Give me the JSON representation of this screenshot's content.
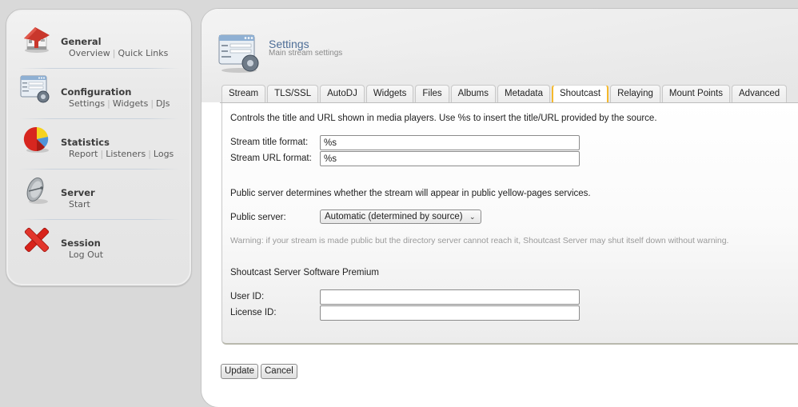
{
  "sidebar": {
    "groups": [
      {
        "title": "General",
        "icon": "house-icon",
        "links": [
          "Overview",
          "Quick Links"
        ]
      },
      {
        "title": "Configuration",
        "icon": "settings-form-icon",
        "links": [
          "Settings",
          "Widgets",
          "DJs"
        ]
      },
      {
        "title": "Statistics",
        "icon": "pie-chart-icon",
        "links": [
          "Report",
          "Listeners",
          "Logs"
        ]
      },
      {
        "title": "Server",
        "icon": "satellite-dish-icon",
        "links": [
          "Start"
        ]
      },
      {
        "title": "Session",
        "icon": "red-x-icon",
        "links": [
          "Log Out"
        ]
      }
    ]
  },
  "header": {
    "title": "Settings",
    "subtitle": "Main stream settings",
    "icon": "settings-form-icon"
  },
  "tabs": [
    {
      "label": "Stream",
      "active": false
    },
    {
      "label": "TLS/SSL",
      "active": false
    },
    {
      "label": "AutoDJ",
      "active": false
    },
    {
      "label": "Widgets",
      "active": false
    },
    {
      "label": "Files",
      "active": false
    },
    {
      "label": "Albums",
      "active": false
    },
    {
      "label": "Metadata",
      "active": false
    },
    {
      "label": "Shoutcast",
      "active": true
    },
    {
      "label": "Relaying",
      "active": false
    },
    {
      "label": "Mount Points",
      "active": false
    },
    {
      "label": "Advanced",
      "active": false
    }
  ],
  "form": {
    "intro": "Controls the title and URL shown in media players. Use %s to insert the title/URL provided by the source.",
    "stream_title_label": "Stream title format:",
    "stream_title_value": "%s",
    "stream_url_label": "Stream URL format:",
    "stream_url_value": "%s",
    "public_intro": "Public server determines whether the stream will appear in public yellow-pages services.",
    "public_server_label": "Public server:",
    "public_server_value": "Automatic (determined by source)",
    "warning": "Warning: if your stream is made public but the directory server cannot reach it, Shoutcast Server may shut itself down without warning.",
    "premium_heading": "Shoutcast Server Software Premium",
    "user_id_label": "User ID:",
    "user_id_value": "",
    "license_id_label": "License ID:",
    "license_id_value": ""
  },
  "buttons": {
    "update": "Update",
    "cancel": "Cancel"
  },
  "colors": {
    "title_blue": "#4e6e97",
    "active_tab_accent": "#f5b92c"
  }
}
